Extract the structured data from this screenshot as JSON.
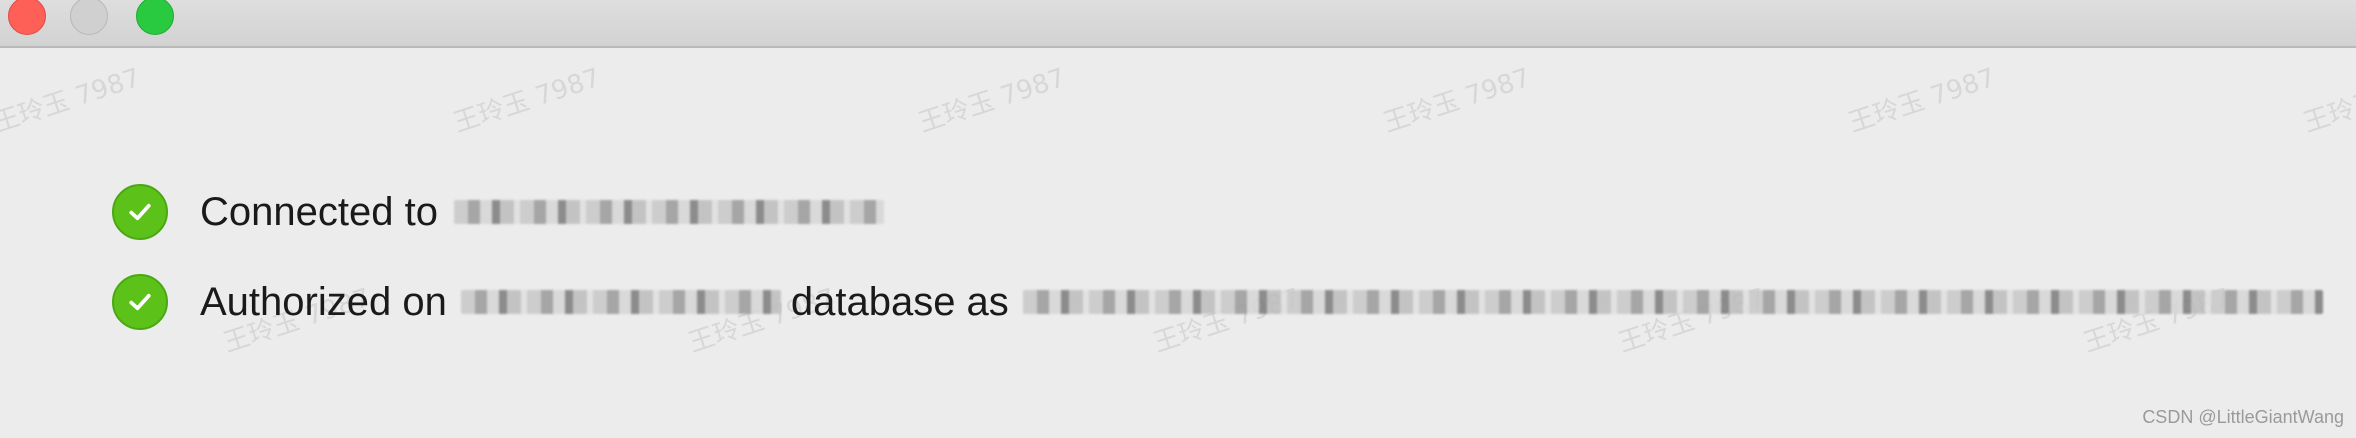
{
  "window": {
    "traffic_lights": [
      {
        "name": "close",
        "color": "#fe5f57"
      },
      {
        "name": "minimize",
        "color": "#d0d0d0"
      },
      {
        "name": "zoom",
        "color": "#29c940"
      }
    ]
  },
  "watermark": {
    "text": "王玲玉 7987"
  },
  "status": {
    "icon": "checkmark-circle-icon",
    "accent_color": "#5cc21a",
    "connected_label": "Connected to",
    "authorized_label": "Authorized on",
    "database_as_label": "database as"
  },
  "footer": {
    "credit": "CSDN @LittleGiantWang"
  }
}
